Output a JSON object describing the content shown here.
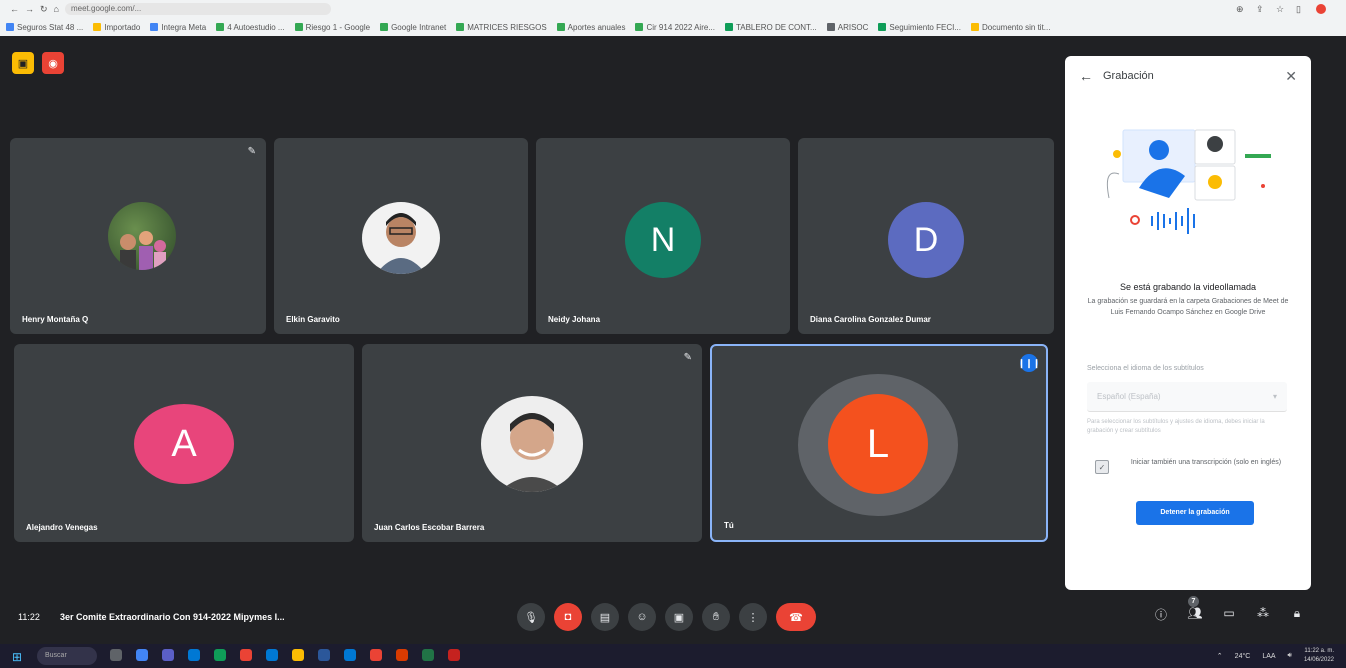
{
  "browser": {
    "url": "meet.google.com/...",
    "bookmarks": [
      {
        "label": "Seguros Stat 48 ...",
        "color": "#4285f4"
      },
      {
        "label": "Importado",
        "color": "#fbbc04"
      },
      {
        "label": "Integra Meta",
        "color": "#4285f4"
      },
      {
        "label": "4 Autoestudio ...",
        "color": "#34a853"
      },
      {
        "label": "Riesgo 1 - Google",
        "color": "#34a853"
      },
      {
        "label": "Google Intranet",
        "color": "#34a853"
      },
      {
        "label": "MATRICES RIESGOS",
        "color": "#34a853"
      },
      {
        "label": "Aportes anuales",
        "color": "#34a853"
      },
      {
        "label": "Cir 914 2022 Aire...",
        "color": "#34a853"
      },
      {
        "label": "TABLERO DE CONT...",
        "color": "#0f9d58"
      },
      {
        "label": "ARISOC",
        "color": "#5f6368"
      },
      {
        "label": "Seguimiento FECI...",
        "color": "#0f9d58"
      },
      {
        "label": "Documento sin tit...",
        "color": "#fbbc04"
      }
    ]
  },
  "participants": [
    {
      "name": "Henry Montaña Q",
      "type": "photo",
      "muted": true
    },
    {
      "name": "Elkin Garavito",
      "type": "photo",
      "muted": false
    },
    {
      "name": "Neidy Johana",
      "type": "initial",
      "initial": "N",
      "color": "#137f66",
      "muted": false
    },
    {
      "name": "Diana Carolina Gonzalez Dumar",
      "type": "initial",
      "initial": "D",
      "color": "#5c6bc0",
      "muted": false
    },
    {
      "name": "Alejandro Venegas",
      "type": "initial",
      "initial": "A",
      "color": "#e8457b",
      "muted": false
    },
    {
      "name": "Juan Carlos Escobar Barrera",
      "type": "photo",
      "muted": true
    },
    {
      "name": "Tú",
      "type": "initial",
      "initial": "L",
      "color": "#f4511e",
      "muted": false,
      "speaking": true
    }
  ],
  "panel": {
    "title": "Grabación",
    "heading": "Se está grabando la videollamada",
    "description": "La grabación se guardará en la carpeta Grabaciones de Meet de Luis Fernando Ocampo Sánchez en Google Drive",
    "language_label": "Selecciona el idioma de los subtítulos",
    "language_value": "Español (España)",
    "language_help": "Para seleccionar los subtítulos y ajustes de idioma, debes iniciar la grabación y crear subtítulos",
    "transcript_text": "Iniciar también una transcripción (solo en inglés)",
    "stop_button": "Detener la grabación"
  },
  "meeting": {
    "time": "11:22",
    "title": "3er Comite Extraordinario Con 914-2022 Mipymes I...",
    "participant_count": "7"
  },
  "taskbar": {
    "search": "Buscar",
    "weather": "24°C",
    "lang": "LAA",
    "time": "11:22 a. m.",
    "date": "14/06/2022"
  }
}
